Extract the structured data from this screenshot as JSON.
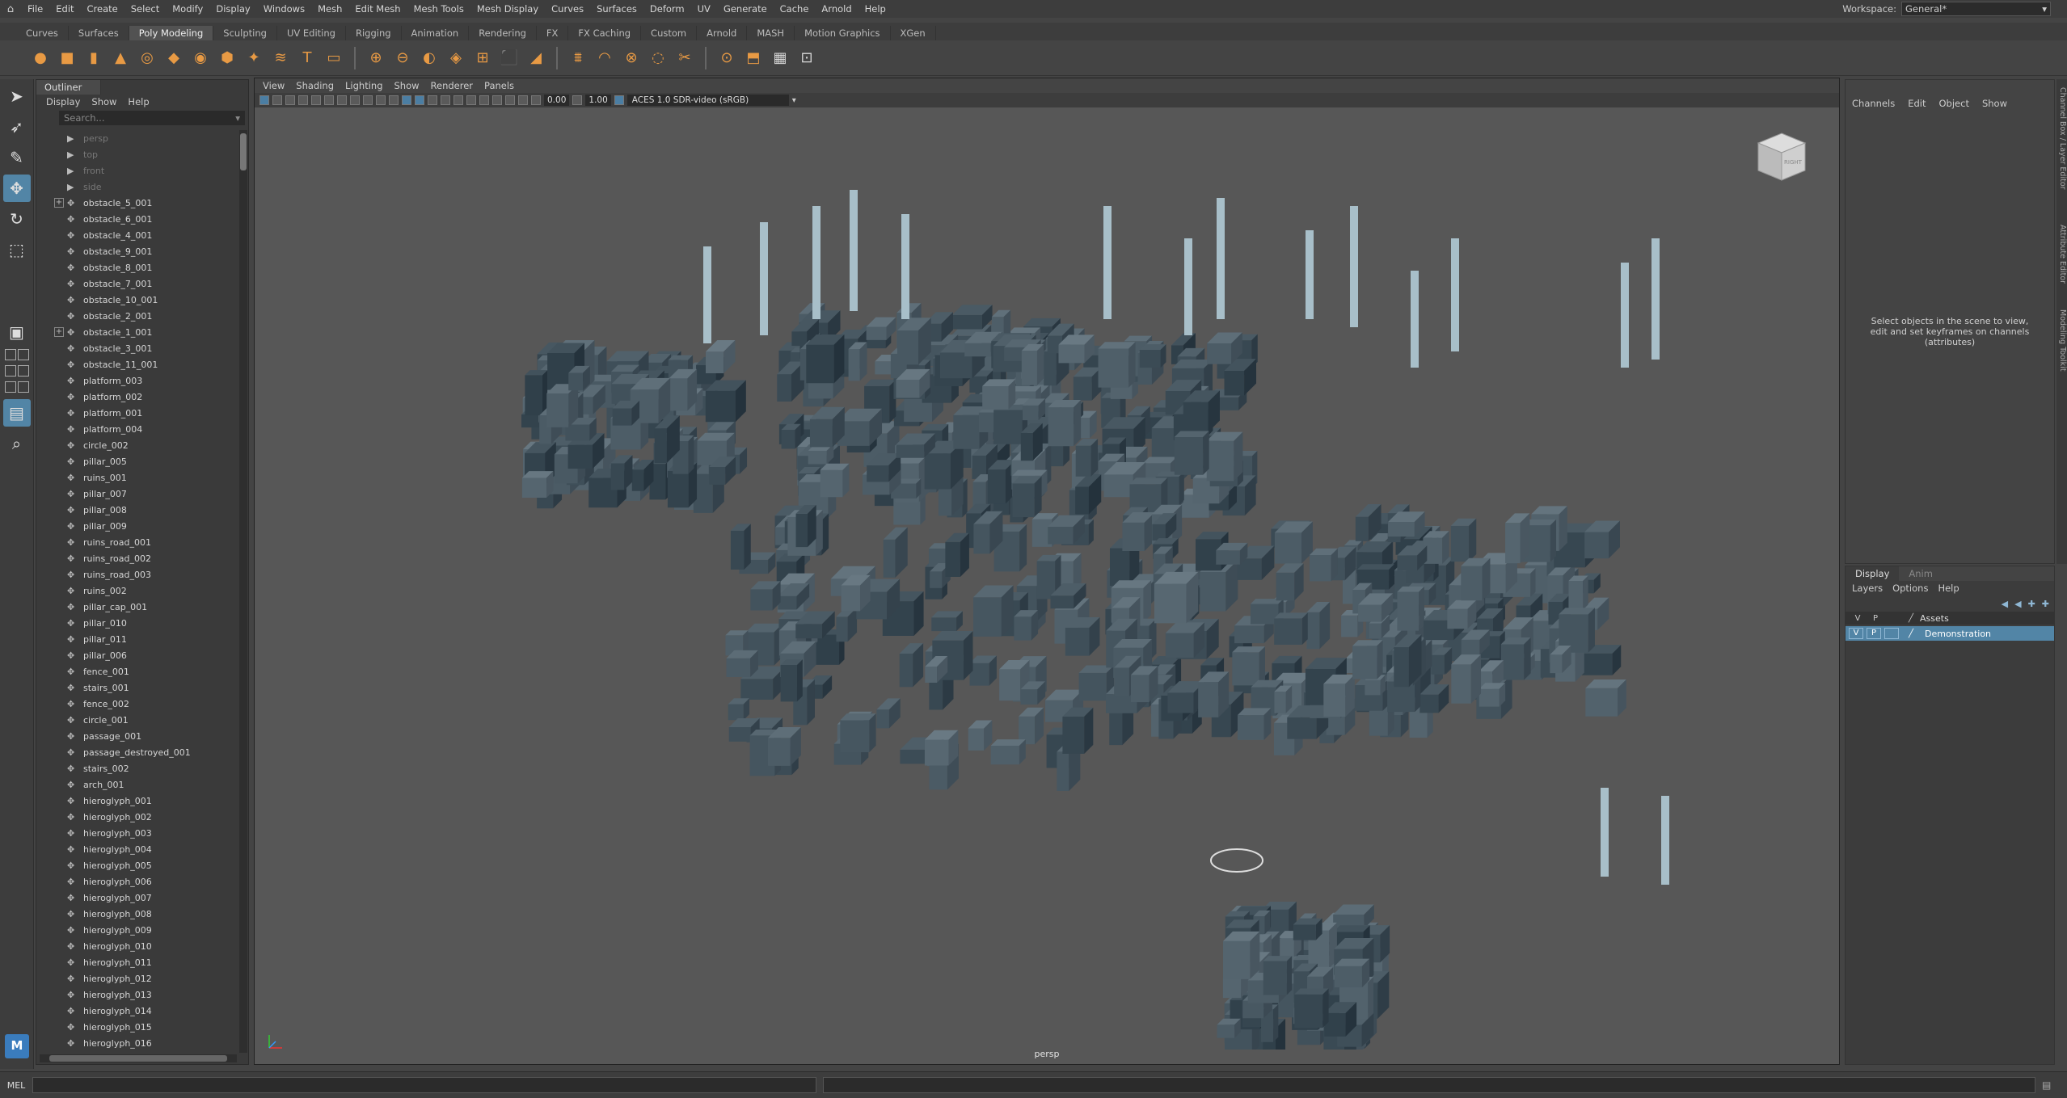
{
  "menubar": {
    "items": [
      "File",
      "Edit",
      "Create",
      "Select",
      "Modify",
      "Display",
      "Windows",
      "Mesh",
      "Edit Mesh",
      "Mesh Tools",
      "Mesh Display",
      "Curves",
      "Surfaces",
      "Deform",
      "UV",
      "Generate",
      "Cache",
      "Arnold",
      "Help"
    ],
    "workspace_label": "Workspace:",
    "workspace_value": "General*"
  },
  "shelf_tabs": {
    "items": [
      "Curves",
      "Surfaces",
      "Poly Modeling",
      "Sculpting",
      "UV Editing",
      "Rigging",
      "Animation",
      "Rendering",
      "FX",
      "FX Caching",
      "Custom",
      "Arnold",
      "MASH",
      "Motion Graphics",
      "XGen"
    ],
    "active": "Poly Modeling"
  },
  "shelf_icons": [
    "sphere-icon",
    "cube-icon",
    "cylinder-icon",
    "cone-icon",
    "torus-icon",
    "plane-icon",
    "disc-icon",
    "platonic-icon",
    "super-shape-icon",
    "sweep-mesh-icon",
    "type-icon",
    "svg-icon",
    "combine-icon",
    "separate-icon",
    "smooth-icon",
    "boolean-icon",
    "mirror-icon",
    "extrude-icon",
    "bevel-icon",
    "bridge-icon",
    "bend-icon",
    "merge-icon",
    "fill-hole-icon",
    "multi-cut-icon",
    "target-weld-icon",
    "quad-draw-icon",
    "retopology-icon",
    "uv-icon"
  ],
  "outliner": {
    "title": "Outliner",
    "menu": [
      "Display",
      "Show",
      "Help"
    ],
    "search_placeholder": "Search...",
    "items": [
      {
        "label": "persp",
        "type": "camera"
      },
      {
        "label": "top",
        "type": "camera"
      },
      {
        "label": "front",
        "type": "camera"
      },
      {
        "label": "side",
        "type": "camera"
      },
      {
        "label": "obstacle_5_001",
        "type": "group"
      },
      {
        "label": "obstacle_6_001",
        "type": "mesh"
      },
      {
        "label": "obstacle_4_001",
        "type": "mesh"
      },
      {
        "label": "obstacle_9_001",
        "type": "mesh"
      },
      {
        "label": "obstacle_8_001",
        "type": "mesh"
      },
      {
        "label": "obstacle_7_001",
        "type": "mesh"
      },
      {
        "label": "obstacle_10_001",
        "type": "mesh"
      },
      {
        "label": "obstacle_2_001",
        "type": "mesh"
      },
      {
        "label": "obstacle_1_001",
        "type": "group"
      },
      {
        "label": "obstacle_3_001",
        "type": "mesh"
      },
      {
        "label": "obstacle_11_001",
        "type": "mesh"
      },
      {
        "label": "platform_003",
        "type": "mesh"
      },
      {
        "label": "platform_002",
        "type": "mesh"
      },
      {
        "label": "platform_001",
        "type": "mesh"
      },
      {
        "label": "platform_004",
        "type": "mesh"
      },
      {
        "label": "circle_002",
        "type": "mesh"
      },
      {
        "label": "pillar_005",
        "type": "mesh"
      },
      {
        "label": "ruins_001",
        "type": "mesh"
      },
      {
        "label": "pillar_007",
        "type": "mesh"
      },
      {
        "label": "pillar_008",
        "type": "mesh"
      },
      {
        "label": "pillar_009",
        "type": "mesh"
      },
      {
        "label": "ruins_road_001",
        "type": "mesh"
      },
      {
        "label": "ruins_road_002",
        "type": "mesh"
      },
      {
        "label": "ruins_road_003",
        "type": "mesh"
      },
      {
        "label": "ruins_002",
        "type": "mesh"
      },
      {
        "label": "pillar_cap_001",
        "type": "mesh"
      },
      {
        "label": "pillar_010",
        "type": "mesh"
      },
      {
        "label": "pillar_011",
        "type": "mesh"
      },
      {
        "label": "pillar_006",
        "type": "mesh"
      },
      {
        "label": "fence_001",
        "type": "mesh"
      },
      {
        "label": "stairs_001",
        "type": "mesh"
      },
      {
        "label": "fence_002",
        "type": "mesh"
      },
      {
        "label": "circle_001",
        "type": "mesh"
      },
      {
        "label": "passage_001",
        "type": "mesh"
      },
      {
        "label": "passage_destroyed_001",
        "type": "mesh"
      },
      {
        "label": "stairs_002",
        "type": "mesh"
      },
      {
        "label": "arch_001",
        "type": "mesh"
      },
      {
        "label": "hieroglyph_001",
        "type": "mesh"
      },
      {
        "label": "hieroglyph_002",
        "type": "mesh"
      },
      {
        "label": "hieroglyph_003",
        "type": "mesh"
      },
      {
        "label": "hieroglyph_004",
        "type": "mesh"
      },
      {
        "label": "hieroglyph_005",
        "type": "mesh"
      },
      {
        "label": "hieroglyph_006",
        "type": "mesh"
      },
      {
        "label": "hieroglyph_007",
        "type": "mesh"
      },
      {
        "label": "hieroglyph_008",
        "type": "mesh"
      },
      {
        "label": "hieroglyph_009",
        "type": "mesh"
      },
      {
        "label": "hieroglyph_010",
        "type": "mesh"
      },
      {
        "label": "hieroglyph_011",
        "type": "mesh"
      },
      {
        "label": "hieroglyph_012",
        "type": "mesh"
      },
      {
        "label": "hieroglyph_013",
        "type": "mesh"
      },
      {
        "label": "hieroglyph_014",
        "type": "mesh"
      },
      {
        "label": "hieroglyph_015",
        "type": "mesh"
      },
      {
        "label": "hieroglyph_016",
        "type": "mesh"
      }
    ]
  },
  "viewport": {
    "menu": [
      "View",
      "Shading",
      "Lighting",
      "Show",
      "Renderer",
      "Panels"
    ],
    "exposure": "0.00",
    "gamma": "1.00",
    "color_space": "ACES 1.0 SDR-video (sRGB)",
    "camera_label": "persp",
    "viewcube_label": "RIGHT"
  },
  "channel_box": {
    "menu": [
      "Channels",
      "Edit",
      "Object",
      "Show"
    ],
    "message": "Select objects in the scene to view, edit and set keyframes on channels (attributes)"
  },
  "side_tabs": [
    "Channel Box / Layer Editor",
    "Attribute Editor",
    "Modeling Toolkit"
  ],
  "layer_editor": {
    "tabs": [
      "Display",
      "Anim"
    ],
    "menu": [
      "Layers",
      "Options",
      "Help"
    ],
    "header": {
      "v": "V",
      "p": "P",
      "name": "Assets"
    },
    "layers": [
      {
        "v": "V",
        "p": "P",
        "name": "Demonstration"
      }
    ],
    "active_color": "#5285a6"
  },
  "command_line": {
    "label": "MEL"
  },
  "badge": "M"
}
